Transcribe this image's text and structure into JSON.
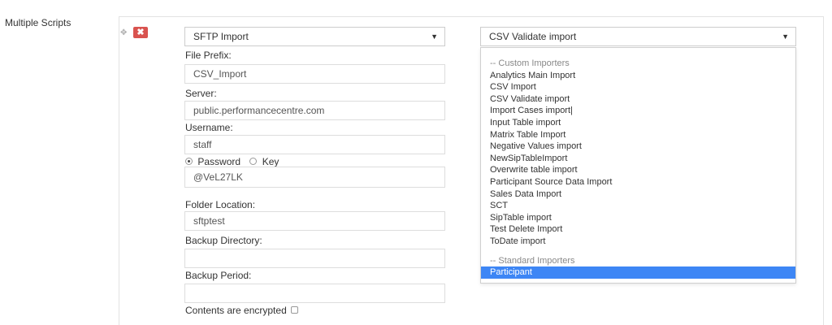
{
  "section": {
    "label": "Multiple Scripts"
  },
  "script_row": {
    "move_icon": "move-icon",
    "remove_icon_glyph": "✖"
  },
  "left_select": {
    "value": "SFTP Import"
  },
  "right_select": {
    "value": "CSV Validate import"
  },
  "form": {
    "file_prefix_label": "File Prefix:",
    "file_prefix_value": "CSV_Import",
    "server_label": "Server:",
    "server_value": "public.performancecentre.com",
    "username_label": "Username:",
    "username_value": "staff",
    "auth_password_label": "Password",
    "auth_key_label": "Key",
    "auth_selected": "Password",
    "password_value": "@VeL27LK",
    "folder_label": "Folder Location:",
    "folder_value": "sftptest",
    "backup_dir_label": "Backup Directory:",
    "backup_dir_value": "",
    "backup_period_label": "Backup Period:",
    "backup_period_value": "",
    "encrypted_label": "Contents are encrypted"
  },
  "dropdown": {
    "groups": [
      {
        "label": "-- Custom Importers",
        "items": [
          "Analytics Main Import",
          "CSV Import",
          "CSV Validate import",
          "Import Cases import|",
          "Input Table import",
          "Matrix Table Import",
          "Negative Values import",
          "NewSipTableImport",
          "Overwrite table import",
          "Participant Source Data Import",
          "Sales Data Import",
          "SCT",
          "SipTable import",
          "Test Delete Import",
          "ToDate import"
        ]
      },
      {
        "label": "-- Standard Importers",
        "items": [
          "Participant"
        ]
      }
    ],
    "highlighted": "Participant"
  },
  "colors": {
    "highlight": "#3d86f5",
    "remove_button": "#d9534f"
  }
}
